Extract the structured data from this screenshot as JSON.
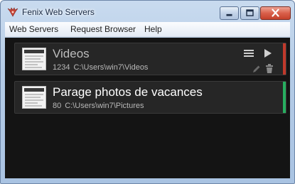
{
  "window": {
    "title": "Fenix Web Servers",
    "icon": "fenix-logo-icon",
    "buttons": [
      "minimize-icon",
      "maximize-icon",
      "close-icon"
    ]
  },
  "menu": {
    "items": [
      {
        "label": "Web Servers"
      },
      {
        "label": "Request Browser"
      },
      {
        "label": "Help"
      }
    ]
  },
  "servers": [
    {
      "name": "Videos",
      "count": "1234",
      "path": "C:\\Users\\win7\\Videos",
      "status_color": "#c0392b",
      "selected": false,
      "actions": [
        "menu-icon",
        "play-icon",
        "edit-icon",
        "trash-icon"
      ]
    },
    {
      "name": "Parage photos de vacances",
      "count": "80",
      "path": "C:\\Users\\win7\\Pictures",
      "status_color": "#27ae60",
      "selected": true
    }
  ],
  "colors": {
    "content_background": "#141414",
    "card_background": "#262626",
    "inactive_name": "#bdbdbd",
    "active_name": "#ffffff"
  }
}
